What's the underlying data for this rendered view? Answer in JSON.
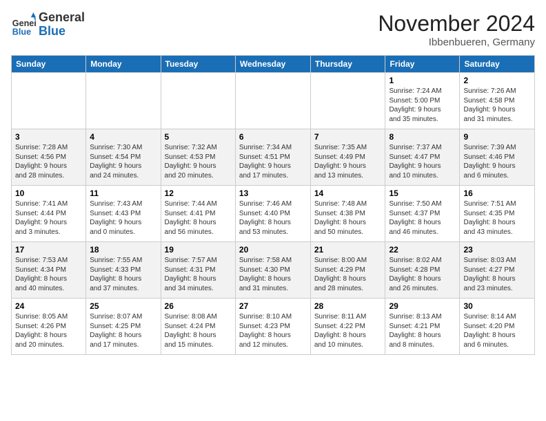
{
  "header": {
    "logo_line1": "General",
    "logo_line2": "Blue",
    "month": "November 2024",
    "location": "Ibbenbueren, Germany"
  },
  "weekdays": [
    "Sunday",
    "Monday",
    "Tuesday",
    "Wednesday",
    "Thursday",
    "Friday",
    "Saturday"
  ],
  "weeks": [
    [
      {
        "day": "",
        "info": ""
      },
      {
        "day": "",
        "info": ""
      },
      {
        "day": "",
        "info": ""
      },
      {
        "day": "",
        "info": ""
      },
      {
        "day": "",
        "info": ""
      },
      {
        "day": "1",
        "info": "Sunrise: 7:24 AM\nSunset: 5:00 PM\nDaylight: 9 hours\nand 35 minutes."
      },
      {
        "day": "2",
        "info": "Sunrise: 7:26 AM\nSunset: 4:58 PM\nDaylight: 9 hours\nand 31 minutes."
      }
    ],
    [
      {
        "day": "3",
        "info": "Sunrise: 7:28 AM\nSunset: 4:56 PM\nDaylight: 9 hours\nand 28 minutes."
      },
      {
        "day": "4",
        "info": "Sunrise: 7:30 AM\nSunset: 4:54 PM\nDaylight: 9 hours\nand 24 minutes."
      },
      {
        "day": "5",
        "info": "Sunrise: 7:32 AM\nSunset: 4:53 PM\nDaylight: 9 hours\nand 20 minutes."
      },
      {
        "day": "6",
        "info": "Sunrise: 7:34 AM\nSunset: 4:51 PM\nDaylight: 9 hours\nand 17 minutes."
      },
      {
        "day": "7",
        "info": "Sunrise: 7:35 AM\nSunset: 4:49 PM\nDaylight: 9 hours\nand 13 minutes."
      },
      {
        "day": "8",
        "info": "Sunrise: 7:37 AM\nSunset: 4:47 PM\nDaylight: 9 hours\nand 10 minutes."
      },
      {
        "day": "9",
        "info": "Sunrise: 7:39 AM\nSunset: 4:46 PM\nDaylight: 9 hours\nand 6 minutes."
      }
    ],
    [
      {
        "day": "10",
        "info": "Sunrise: 7:41 AM\nSunset: 4:44 PM\nDaylight: 9 hours\nand 3 minutes."
      },
      {
        "day": "11",
        "info": "Sunrise: 7:43 AM\nSunset: 4:43 PM\nDaylight: 9 hours\nand 0 minutes."
      },
      {
        "day": "12",
        "info": "Sunrise: 7:44 AM\nSunset: 4:41 PM\nDaylight: 8 hours\nand 56 minutes."
      },
      {
        "day": "13",
        "info": "Sunrise: 7:46 AM\nSunset: 4:40 PM\nDaylight: 8 hours\nand 53 minutes."
      },
      {
        "day": "14",
        "info": "Sunrise: 7:48 AM\nSunset: 4:38 PM\nDaylight: 8 hours\nand 50 minutes."
      },
      {
        "day": "15",
        "info": "Sunrise: 7:50 AM\nSunset: 4:37 PM\nDaylight: 8 hours\nand 46 minutes."
      },
      {
        "day": "16",
        "info": "Sunrise: 7:51 AM\nSunset: 4:35 PM\nDaylight: 8 hours\nand 43 minutes."
      }
    ],
    [
      {
        "day": "17",
        "info": "Sunrise: 7:53 AM\nSunset: 4:34 PM\nDaylight: 8 hours\nand 40 minutes."
      },
      {
        "day": "18",
        "info": "Sunrise: 7:55 AM\nSunset: 4:33 PM\nDaylight: 8 hours\nand 37 minutes."
      },
      {
        "day": "19",
        "info": "Sunrise: 7:57 AM\nSunset: 4:31 PM\nDaylight: 8 hours\nand 34 minutes."
      },
      {
        "day": "20",
        "info": "Sunrise: 7:58 AM\nSunset: 4:30 PM\nDaylight: 8 hours\nand 31 minutes."
      },
      {
        "day": "21",
        "info": "Sunrise: 8:00 AM\nSunset: 4:29 PM\nDaylight: 8 hours\nand 28 minutes."
      },
      {
        "day": "22",
        "info": "Sunrise: 8:02 AM\nSunset: 4:28 PM\nDaylight: 8 hours\nand 26 minutes."
      },
      {
        "day": "23",
        "info": "Sunrise: 8:03 AM\nSunset: 4:27 PM\nDaylight: 8 hours\nand 23 minutes."
      }
    ],
    [
      {
        "day": "24",
        "info": "Sunrise: 8:05 AM\nSunset: 4:26 PM\nDaylight: 8 hours\nand 20 minutes."
      },
      {
        "day": "25",
        "info": "Sunrise: 8:07 AM\nSunset: 4:25 PM\nDaylight: 8 hours\nand 17 minutes."
      },
      {
        "day": "26",
        "info": "Sunrise: 8:08 AM\nSunset: 4:24 PM\nDaylight: 8 hours\nand 15 minutes."
      },
      {
        "day": "27",
        "info": "Sunrise: 8:10 AM\nSunset: 4:23 PM\nDaylight: 8 hours\nand 12 minutes."
      },
      {
        "day": "28",
        "info": "Sunrise: 8:11 AM\nSunset: 4:22 PM\nDaylight: 8 hours\nand 10 minutes."
      },
      {
        "day": "29",
        "info": "Sunrise: 8:13 AM\nSunset: 4:21 PM\nDaylight: 8 hours\nand 8 minutes."
      },
      {
        "day": "30",
        "info": "Sunrise: 8:14 AM\nSunset: 4:20 PM\nDaylight: 8 hours\nand 6 minutes."
      }
    ]
  ]
}
